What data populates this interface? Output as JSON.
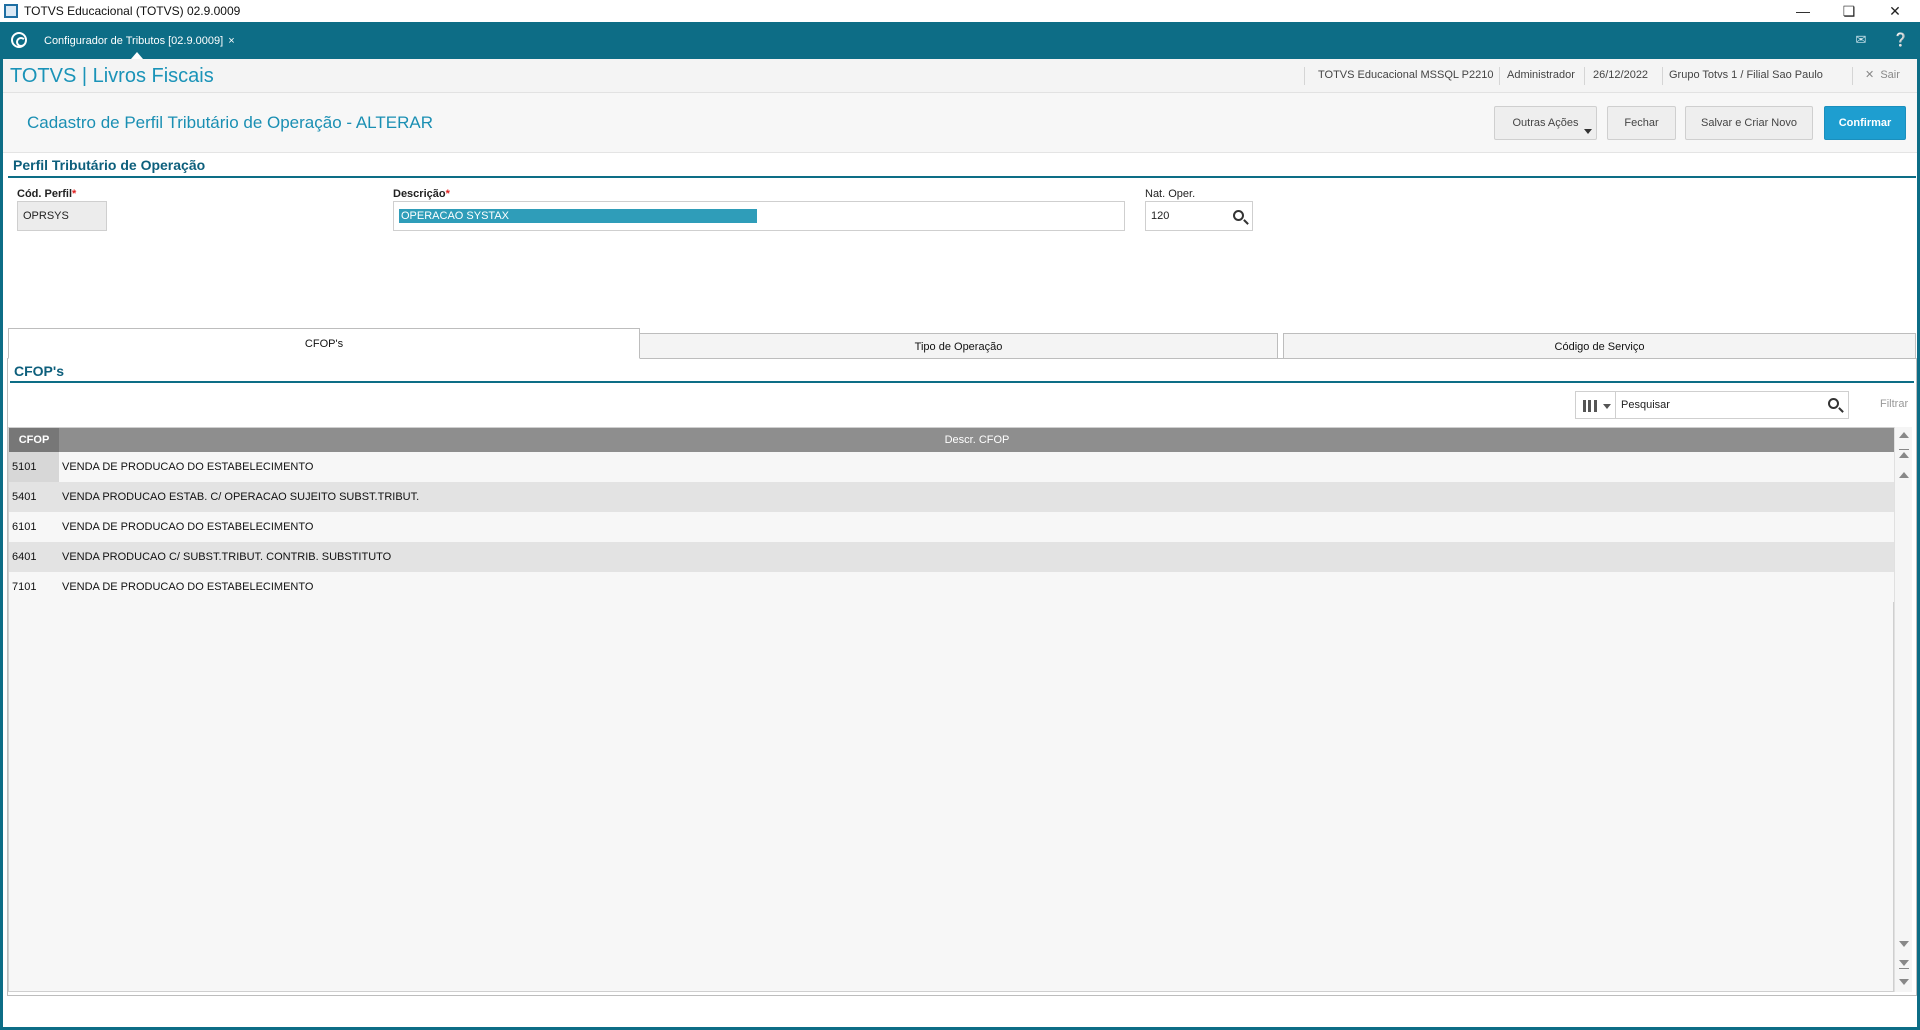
{
  "window": {
    "title": "TOTVS Educacional (TOTVS) 02.9.0009"
  },
  "tabbar": {
    "tab_label": "Configurador de Tributos [02.9.0009]",
    "tab_close": "×"
  },
  "header": {
    "brand": "TOTVS | Livros Fiscais",
    "database": "TOTVS Educacional MSSQL P2210",
    "user": "Administrador",
    "date": "26/12/2022",
    "company": "Grupo Totvs 1 / Filial Sao Paulo",
    "exit_label": "Sair"
  },
  "page": {
    "title": "Cadastro de Perfil Tributário de Operação - ALTERAR",
    "buttons": {
      "other_actions": "Outras Ações",
      "close": "Fechar",
      "save_new": "Salvar e Criar Novo",
      "confirm": "Confirmar"
    }
  },
  "profile_section": {
    "title": "Perfil Tributário de Operação",
    "cod_label": "Cód. Perfil",
    "cod_value": "OPRSYS",
    "desc_label": "Descrição",
    "desc_value": "OPERACAO SYSTAX",
    "nat_label": "Nat. Oper.",
    "nat_value": "120",
    "required_mark": "*"
  },
  "tabs": [
    "CFOP's",
    "Tipo de Operação",
    "Código de Serviço"
  ],
  "cfop_section": {
    "title": "CFOP's",
    "search_placeholder": "Pesquisar",
    "filter_label": "Filtrar",
    "columns": [
      "CFOP",
      "Descr. CFOP"
    ],
    "rows": [
      {
        "cfop": "5101",
        "desc": "VENDA DE PRODUCAO DO ESTABELECIMENTO"
      },
      {
        "cfop": "5401",
        "desc": "VENDA PRODUCAO ESTAB. C/ OPERACAO SUJEITO SUBST.TRIBUT."
      },
      {
        "cfop": "6101",
        "desc": "VENDA DE PRODUCAO DO ESTABELECIMENTO"
      },
      {
        "cfop": "6401",
        "desc": "VENDA PRODUCAO C/ SUBST.TRIBUT. CONTRIB. SUBSTITUTO"
      },
      {
        "cfop": "7101",
        "desc": "VENDA DE PRODUCAO DO ESTABELECIMENTO"
      }
    ]
  },
  "colors": {
    "accent": "#0d6d86",
    "brand": "#1a93b8",
    "primary_button": "#1e9ed0",
    "selection": "#2f9db9"
  },
  "icons": [
    "app-icon",
    "home-icon",
    "mail-icon",
    "help-icon",
    "close-icon",
    "search-icon",
    "columns-icon",
    "chevron-down-icon",
    "scroll-up-icon",
    "scroll-down-icon"
  ]
}
